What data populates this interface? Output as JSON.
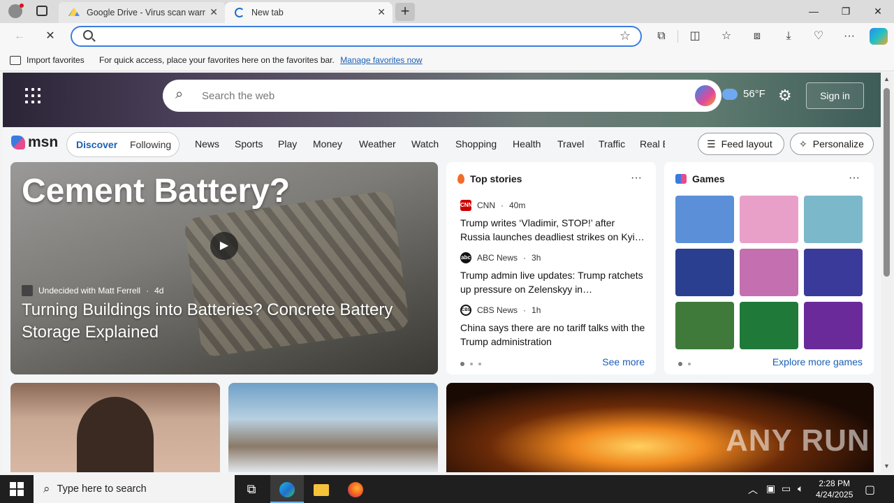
{
  "browser": {
    "tabs": [
      {
        "title": "Google Drive - Virus scan warning",
        "close": "✕"
      },
      {
        "title": "New tab",
        "close": "✕"
      }
    ],
    "new_tab": "+",
    "window_controls": {
      "minimize": "—",
      "restore": "❐",
      "close": "✕"
    },
    "address": {
      "value": "",
      "placeholder": ""
    },
    "favorites_bar": {
      "import_label": "Import favorites",
      "hint": "For quick access, place your favorites here on the favorites bar.",
      "manage_link": "Manage favorites now"
    }
  },
  "msn": {
    "search_placeholder": "Search the web",
    "temperature": "56°F",
    "sign_in": "Sign in",
    "logo_text": "msn",
    "feed_tabs": {
      "discover": "Discover",
      "following": "Following"
    },
    "nav": [
      "News",
      "Sports",
      "Play",
      "Money",
      "Weather",
      "Watch",
      "Shopping",
      "Health",
      "Travel",
      "Traffic",
      "Real E"
    ],
    "feed_layout": "Feed layout",
    "personalize": "Personalize",
    "main_story": {
      "overlay_text": "Cement Battery?",
      "source": "Undecided with Matt Ferrell",
      "age": "4d",
      "title": "Turning Buildings into Batteries? Concrete Battery Storage Explained"
    },
    "top_stories": {
      "title": "Top stories",
      "more": "···",
      "items": [
        {
          "source": "CNN",
          "age": "40m",
          "logo": "CNN",
          "headline": "Trump writes ‘Vladimir, STOP!’ after Russia launches deadliest strikes on Kyi…"
        },
        {
          "source": "ABC News",
          "age": "3h",
          "logo": "abc",
          "headline": "Trump admin live updates: Trump ratchets up pressure on Zelenskyy in…"
        },
        {
          "source": "CBS News",
          "age": "1h",
          "logo": "CBS",
          "headline": "China says there are no tariff talks with the Trump administration"
        }
      ],
      "see_more": "See more"
    },
    "games": {
      "title": "Games",
      "more": "···",
      "explore": "Explore more games",
      "tiles": [
        {
          "color": "#5b8fd8"
        },
        {
          "color": "#e8a0c8"
        },
        {
          "color": "#7bb8c9"
        },
        {
          "color": "#2a3f8f"
        },
        {
          "color": "#c46fb0"
        },
        {
          "color": "#3a3a9a"
        },
        {
          "color": "#3f7a3a"
        },
        {
          "color": "#1f7a3a"
        },
        {
          "color": "#6a2a9a"
        }
      ]
    },
    "watermark": "ANY RUN"
  },
  "taskbar": {
    "search_placeholder": "Type here to search",
    "time": "2:28 PM",
    "date": "4/24/2025"
  }
}
